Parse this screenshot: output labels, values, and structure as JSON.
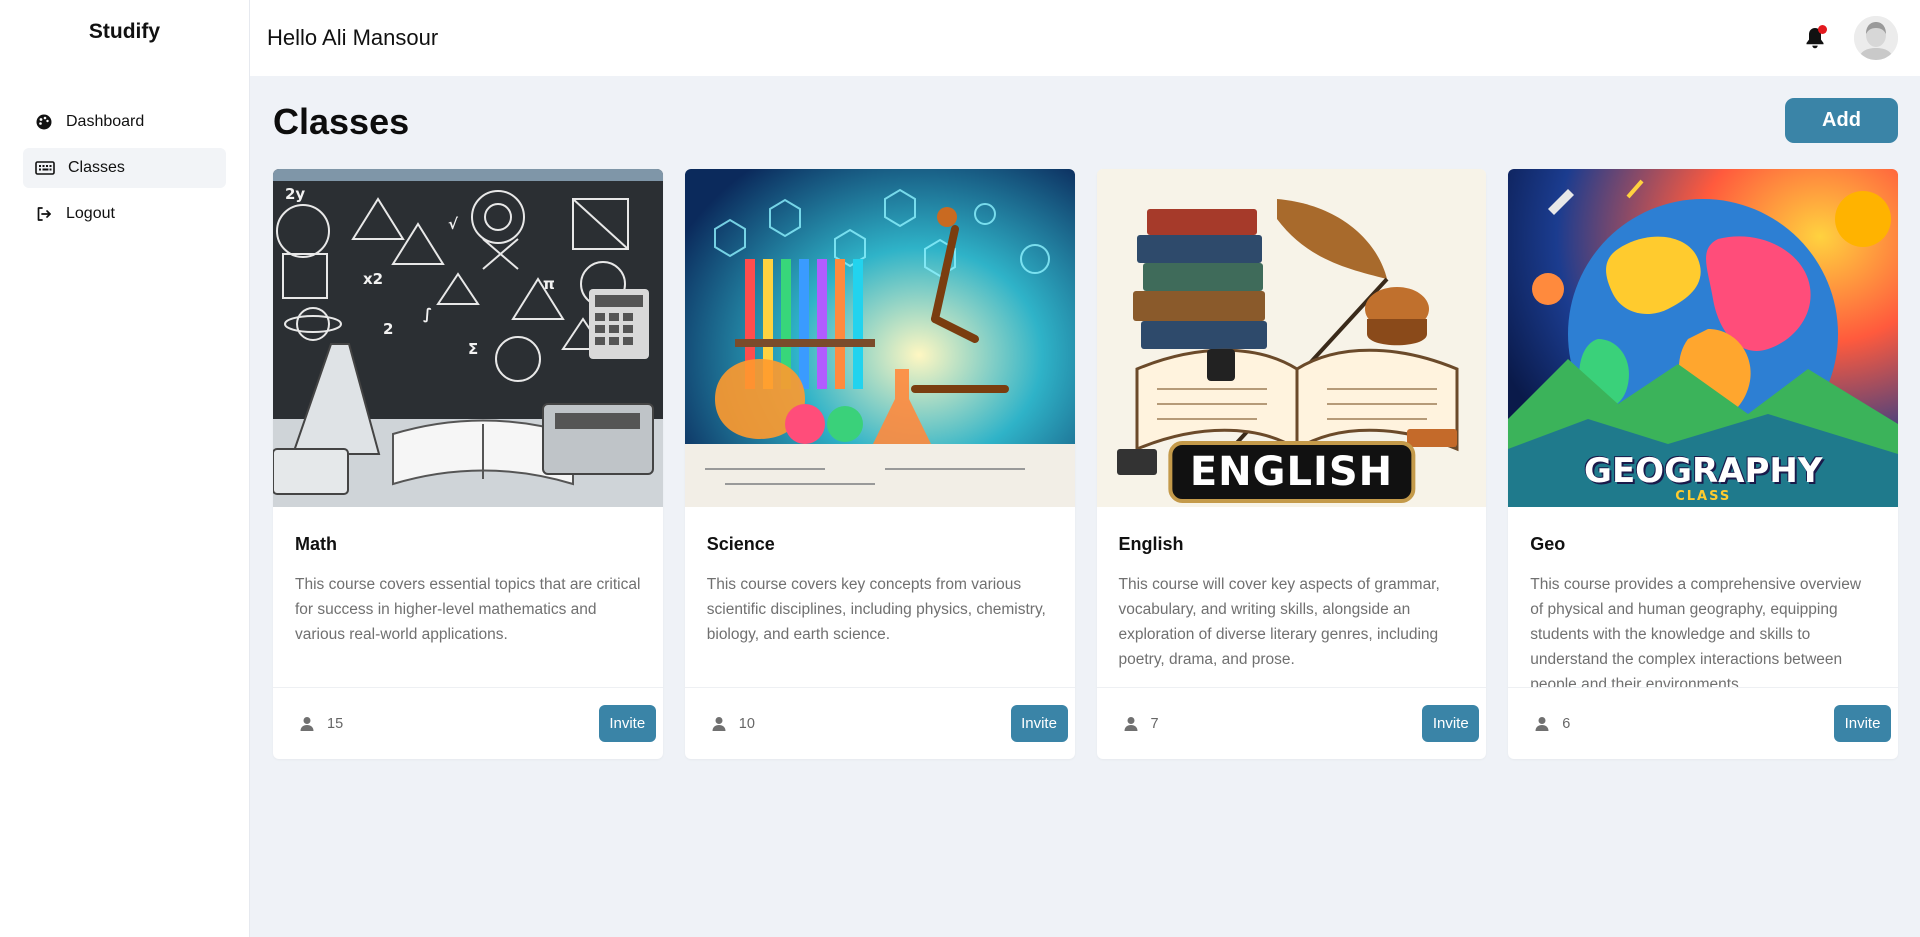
{
  "app": {
    "name": "Studify"
  },
  "sidebar": {
    "items": [
      {
        "label": "Dashboard",
        "icon": "palette-icon",
        "active": false
      },
      {
        "label": "Classes",
        "icon": "keyboard-icon",
        "active": true
      },
      {
        "label": "Logout",
        "icon": "logout-icon",
        "active": false
      }
    ]
  },
  "topbar": {
    "greeting": "Hello Ali Mansour",
    "notification_icon": "bell-icon",
    "has_unread_notification": true,
    "avatar_icon": "user-avatar"
  },
  "page": {
    "title": "Classes",
    "add_label": "Add"
  },
  "classes": [
    {
      "title": "Math",
      "description": "This course covers essential topics that are critical for success in higher-level mathematics and various real-world applications.",
      "members": "15",
      "invite_label": "Invite",
      "image": "math-illustration"
    },
    {
      "title": "Science",
      "description": "This course covers key concepts from various scientific disciplines, including physics, chemistry, biology, and earth science.",
      "members": "10",
      "invite_label": "Invite",
      "image": "science-illustration"
    },
    {
      "title": "English",
      "description": "This course will cover key aspects of grammar, vocabulary, and writing skills, alongside an exploration of diverse literary genres, including poetry, drama, and prose.",
      "members": "7",
      "invite_label": "Invite",
      "image": "english-illustration",
      "image_text": "ENGLISH"
    },
    {
      "title": "Geo",
      "description": "This course provides a comprehensive overview of physical and human geography, equipping students with the knowledge and skills to understand the complex interactions between people and their environments",
      "members": "6",
      "invite_label": "Invite",
      "image": "geography-illustration",
      "image_text": "GEOGRAPHY",
      "image_subtext": "CLASS"
    }
  ],
  "colors": {
    "accent": "#3a84a7",
    "background": "#eff2f7",
    "notification_dot": "#e3191e"
  }
}
